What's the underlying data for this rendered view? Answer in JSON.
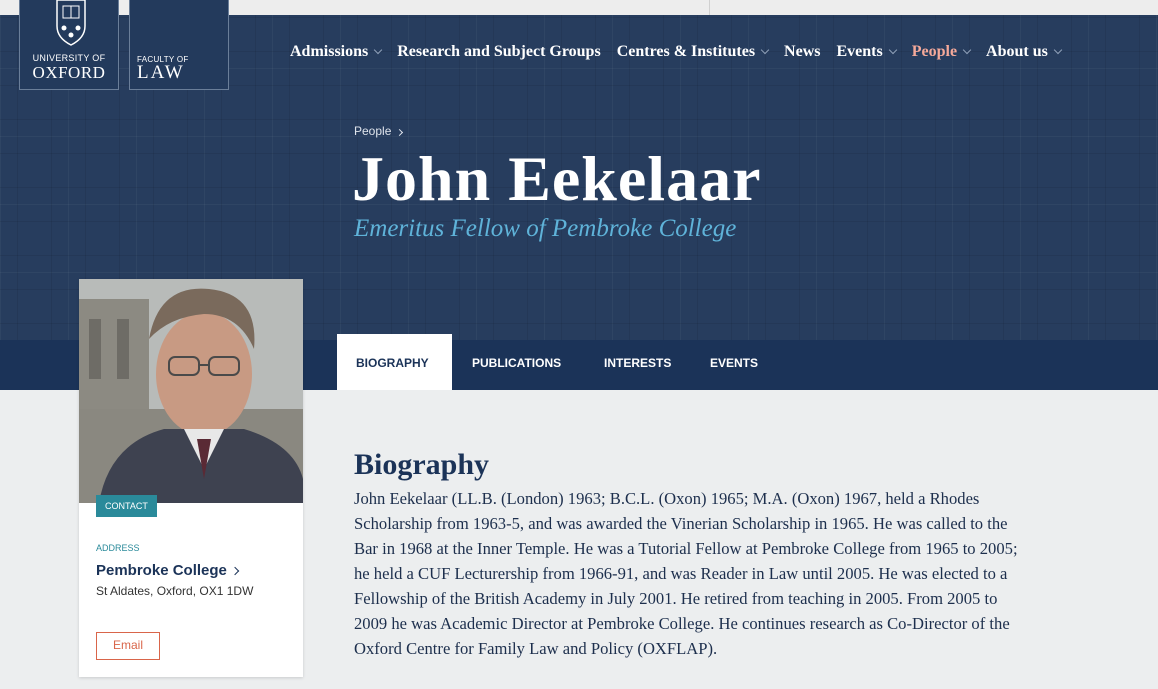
{
  "logos": {
    "oxford_line1": "UNIVERSITY OF",
    "oxford_line2": "OXFORD",
    "law_line1": "FACULTY OF",
    "law_line2": "LAW"
  },
  "nav": {
    "items": [
      {
        "label": "Admissions",
        "has_dropdown": true
      },
      {
        "label": "Research and Subject Groups",
        "has_dropdown": false
      },
      {
        "label": "Centres & Institutes",
        "has_dropdown": true
      },
      {
        "label": "News",
        "has_dropdown": false
      },
      {
        "label": "Events",
        "has_dropdown": true
      },
      {
        "label": "People",
        "has_dropdown": true,
        "active": true
      },
      {
        "label": "About us",
        "has_dropdown": true
      }
    ]
  },
  "breadcrumb": {
    "label": "People"
  },
  "profile": {
    "name": "John Eekelaar",
    "role": "Emeritus Fellow of Pembroke College"
  },
  "tabs": [
    {
      "label": "BIOGRAPHY",
      "active": true
    },
    {
      "label": "PUBLICATIONS"
    },
    {
      "label": "INTERESTS"
    },
    {
      "label": "EVENTS"
    }
  ],
  "card": {
    "badge": "CONTACT",
    "address_label": "ADDRESS",
    "college": "Pembroke College",
    "street": "St Aldates, Oxford, OX1 1DW",
    "email_label": "Email"
  },
  "biography": {
    "heading": "Biography",
    "text": "John Eekelaar (LL.B. (London) 1963; B.C.L. (Oxon) 1965; M.A. (Oxon) 1967, held a Rhodes Scholarship from 1963-5, and was awarded the Vinerian Scholarship in 1965. He was called to the Bar in 1968 at the Inner Temple. He was a Tutorial Fellow at Pembroke College from 1965 to 2005; he held a CUF Lecturership from 1966-91, and was Reader in Law until 2005. He was elected to a Fellowship of the British Academy in July 2001. He retired from teaching in 2005. From 2005 to 2009 he was Academic Director at Pembroke College. He continues research as Co-Director of the Oxford Centre for Family Law and Policy (OXFLAP)."
  },
  "colors": {
    "navy": "#1b3358",
    "hero": "#273d5e",
    "teal": "#2a8a9a",
    "active_nav": "#f5a99a",
    "email_accent": "#d9654a",
    "subtitle": "#5fb3d9"
  }
}
